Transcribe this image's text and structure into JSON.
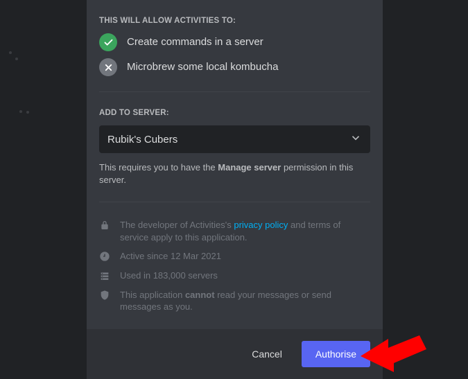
{
  "section_allow_label": "THIS WILL ALLOW ACTIVITIES TO:",
  "permissions": {
    "allow1": "Create commands in a server",
    "deny1": "Microbrew some local kombucha"
  },
  "section_server_label": "ADD TO SERVER:",
  "dropdown": {
    "selected": "Rubik's Cubers"
  },
  "server_hint_prefix": "This requires you to have the ",
  "server_hint_bold": "Manage server",
  "server_hint_suffix": " permission in this server.",
  "info": {
    "privacy_pre": "The developer of Activities's ",
    "privacy_link": "privacy policy",
    "privacy_post": " and terms of service apply to this application.",
    "active": "Active since 12 Mar 2021",
    "used": "Used in 183,000 servers",
    "shield_pre": "This application ",
    "shield_bold": "cannot",
    "shield_post": " read your messages or send messages as you."
  },
  "buttons": {
    "cancel": "Cancel",
    "authorise": "Authorise"
  }
}
